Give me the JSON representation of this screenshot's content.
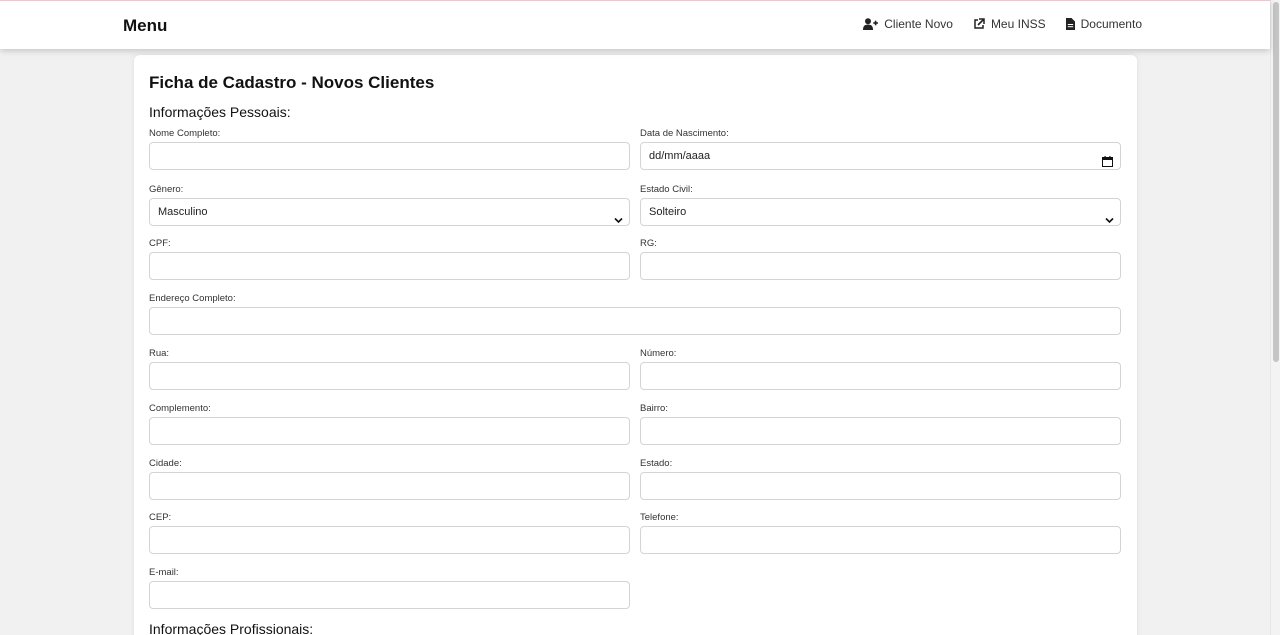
{
  "navbar": {
    "brand": "Menu",
    "links": [
      {
        "label": "Cliente Novo",
        "icon": "user-plus-icon"
      },
      {
        "label": "Meu INSS",
        "icon": "external-link-icon"
      },
      {
        "label": "Documento",
        "icon": "file-icon"
      }
    ]
  },
  "form": {
    "title": "Ficha de Cadastro - Novos Clientes",
    "section_personal": "Informações Pessoais:",
    "section_professional": "Informações Profissionais:",
    "fields": {
      "nome": {
        "label": "Nome Completo:",
        "value": ""
      },
      "nascimento": {
        "label": "Data de Nascimento:",
        "value": "dd/mm/aaaa"
      },
      "genero": {
        "label": "Gênero:",
        "value": "Masculino"
      },
      "estado_civil": {
        "label": "Estado Civil:",
        "value": "Solteiro"
      },
      "cpf": {
        "label": "CPF:",
        "value": ""
      },
      "rg": {
        "label": "RG:",
        "value": ""
      },
      "endereco": {
        "label": "Endereço Completo:",
        "value": ""
      },
      "rua": {
        "label": "Rua:",
        "value": ""
      },
      "numero": {
        "label": "Número:",
        "value": ""
      },
      "complemento": {
        "label": "Complemento:",
        "value": ""
      },
      "bairro": {
        "label": "Bairro:",
        "value": ""
      },
      "cidade": {
        "label": "Cidade:",
        "value": ""
      },
      "estado": {
        "label": "Estado:",
        "value": ""
      },
      "cep": {
        "label": "CEP:",
        "value": ""
      },
      "telefone": {
        "label": "Telefone:",
        "value": ""
      },
      "email": {
        "label": "E-mail:",
        "value": ""
      }
    }
  }
}
